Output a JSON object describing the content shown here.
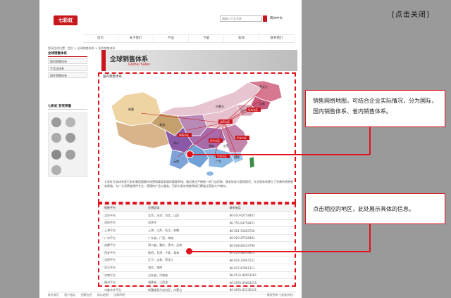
{
  "overlay": {
    "close_label": "[点击关闭]",
    "callout_network": "销售网络地图，可结合企业实际情况，分为国际，国内销售体系、省内销售体系。",
    "callout_region": "点击相应的地区，此处展示具体的信息。",
    "accent_color": "#e0121b"
  },
  "header": {
    "logo_text": "七彩虹",
    "search_placeholder": "请输入产品名称",
    "language": "简体中文",
    "nav": [
      "首页",
      "关于我们",
      "产品",
      "下载",
      "新闻",
      "联系我们"
    ]
  },
  "breadcrumb": "您现在的位置：首页 > 全球销售体系 > 国内销售体系",
  "sidebar": {
    "title": "全球销售体系",
    "items": [
      "国内销售体系",
      "专卖店体系",
      "国外销售体系"
    ],
    "awards_title": "七彩虹 获奖荣誉"
  },
  "banner": {
    "title": "全球销售体系",
    "subtitle": "Global Sales"
  },
  "section_title": "国内销售体系",
  "map": {
    "labels": [
      "黑龙江",
      "吉林",
      "辽宁",
      "内蒙古",
      "新疆",
      "青海",
      "四川",
      "云南",
      "湖南",
      "江西",
      "福建",
      "广东",
      "北京大区",
      "华北大区",
      "华东大区",
      "西南大区",
      "华中大区",
      "华南大区"
    ]
  },
  "description": "七彩虹专卖体系是七彩虹集团遵循市场营销渠道发展的重要举措。通过建立严格统一的门店形象、服务标准与管理规范，在全国各地建立了完善的销售服务网络，为广大消费者提供专业、便捷的产品与服务。目前七彩虹销售网络已覆盖全国各大中城市。",
  "table": {
    "headers": [
      "销售平台",
      "负责区域",
      "联系电话"
    ],
    "rows": [
      [
        "北京平台",
        "北京，天津，河北，山西",
        "86-010-62754801"
      ],
      [
        "深圳平台",
        "深圳市",
        "86-755-83758421"
      ],
      [
        "上海平台",
        "上海，江苏，浙江，安徽",
        "86-021-51063726"
      ],
      [
        "广州平台",
        "广东省，广西，海南",
        "86-020-87526401"
      ],
      [
        "成都平台",
        "四川省，重庆，贵州，云南",
        "86-028-85453790"
      ],
      [
        "西安平台",
        "陕西，甘肃，宁夏，青海",
        "86-029-88309821"
      ],
      [
        "沈阳平台",
        "辽宁，吉林，黑龙江",
        "86-024-22847521"
      ],
      [
        "武汉平台",
        "湖北，湖南",
        "86-027-87861311"
      ],
      [
        "济南平台",
        "山东省，河南省",
        "86-0531-88503281"
      ],
      [
        "福州平台",
        "福建省，江西省",
        "86-0591-83803235"
      ],
      [
        "乌鲁木齐平台",
        "新疆维吾尔自治区，内蒙古",
        "86-0991-85230241"
      ]
    ]
  },
  "footer": {
    "links": [
      "联系我们",
      "客户服务",
      "招聘信息",
      "网站地图",
      "法律声明"
    ],
    "copyright": "版权所有 七彩虹科技"
  }
}
